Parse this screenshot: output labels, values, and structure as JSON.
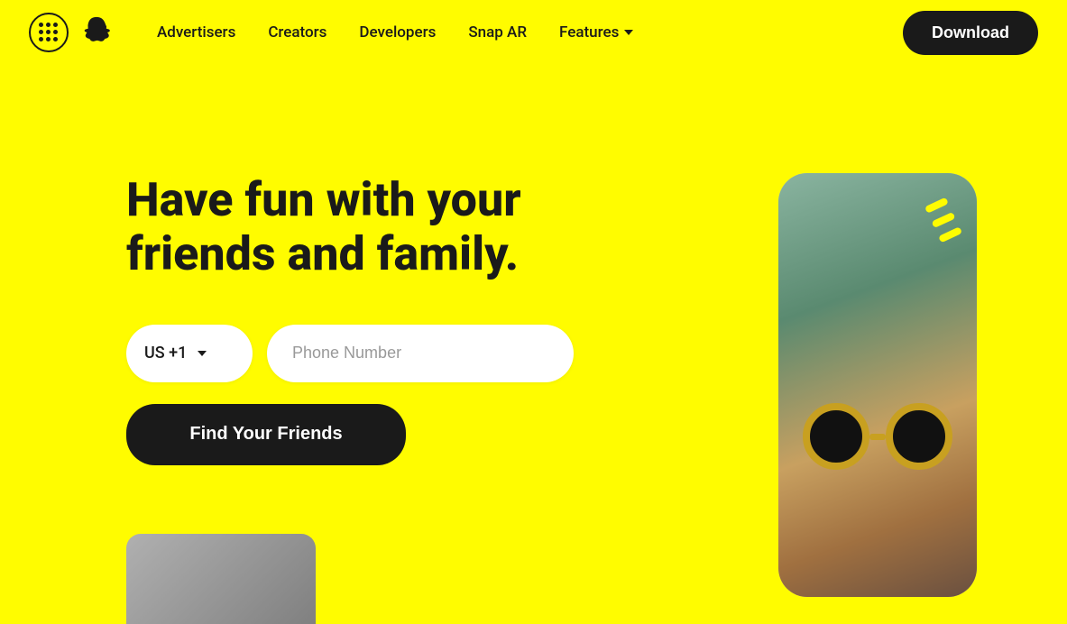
{
  "navbar": {
    "grid_icon_label": "menu",
    "nav_links": [
      {
        "id": "advertisers",
        "label": "Advertisers",
        "has_chevron": false
      },
      {
        "id": "creators",
        "label": "Creators",
        "has_chevron": false
      },
      {
        "id": "developers",
        "label": "Developers",
        "has_chevron": false
      },
      {
        "id": "snap-ar",
        "label": "Snap AR",
        "has_chevron": false
      },
      {
        "id": "features",
        "label": "Features",
        "has_chevron": true
      }
    ],
    "download_label": "Download"
  },
  "hero": {
    "title": "Have fun with your friends and family.",
    "country_code": "US +1",
    "phone_placeholder": "Phone Number",
    "find_friends_label": "Find Your Friends"
  },
  "colors": {
    "bg": "#FFFC00",
    "dark": "#1a1a1a",
    "white": "#FFFFFF"
  }
}
